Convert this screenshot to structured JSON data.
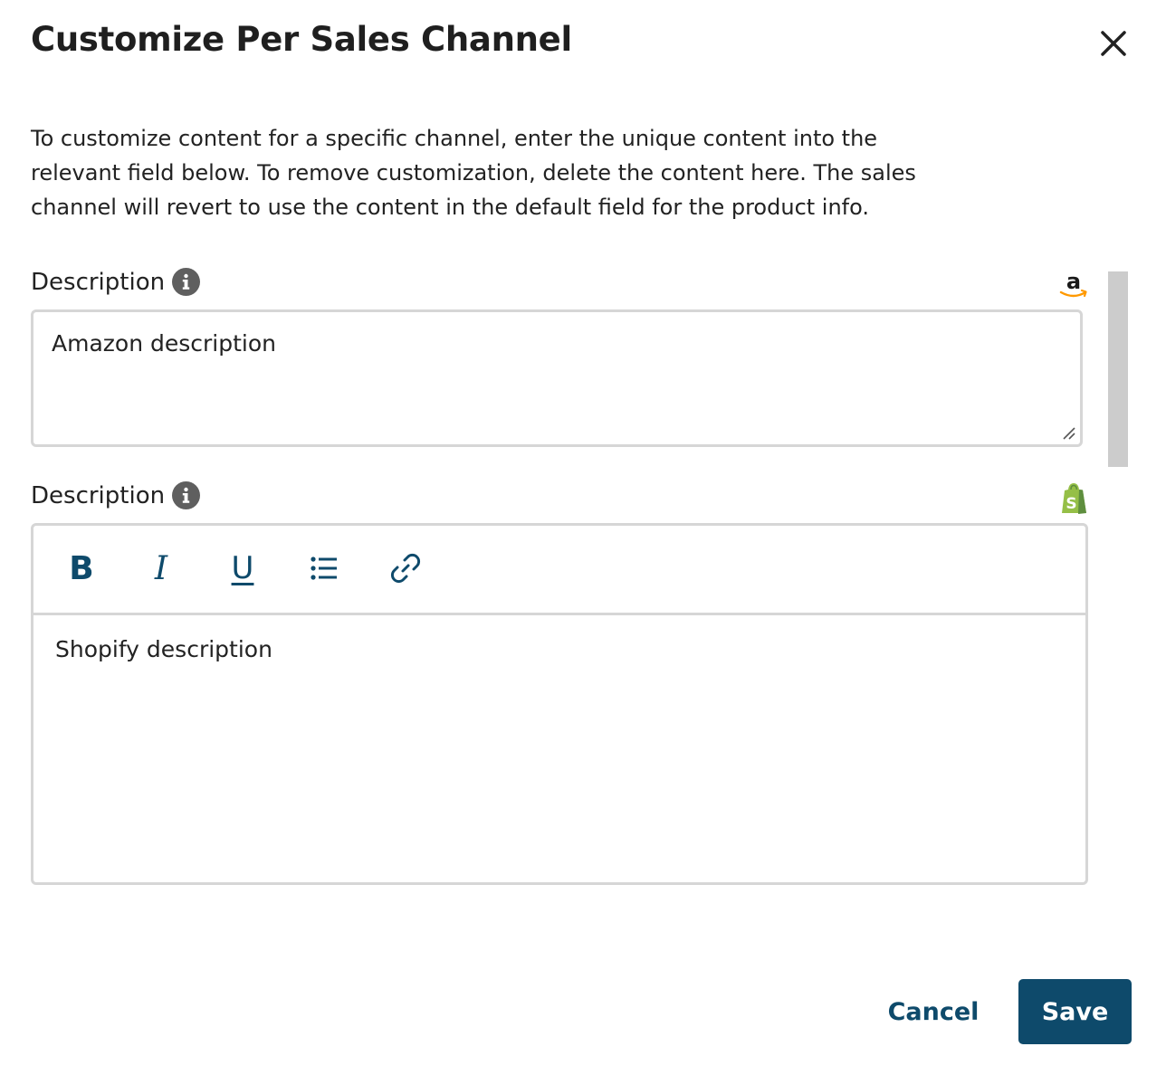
{
  "modal": {
    "title": "Customize Per Sales Channel",
    "intro": "To customize content for a specific channel, enter the unique content into the relevant field below. To remove customization, delete the content here. The sales channel will revert to use the content in the default field for the product info."
  },
  "fields": [
    {
      "label": "Description",
      "channel_icon": "amazon-icon",
      "value": "Amazon description"
    },
    {
      "label": "Description",
      "channel_icon": "shopify-icon",
      "value": "Shopify description",
      "toolbar": {
        "bold": "B",
        "italic": "I",
        "underline": "U",
        "icons": [
          "bullet-list-icon",
          "link-icon"
        ]
      }
    }
  ],
  "footer": {
    "cancel_label": "Cancel",
    "save_label": "Save"
  },
  "colors": {
    "accent": "#0e4a6b",
    "border": "#d6d6d6",
    "info_icon": "#5f5f5f",
    "shopify_green": "#95bf47",
    "amazon_orange": "#ff9900"
  }
}
